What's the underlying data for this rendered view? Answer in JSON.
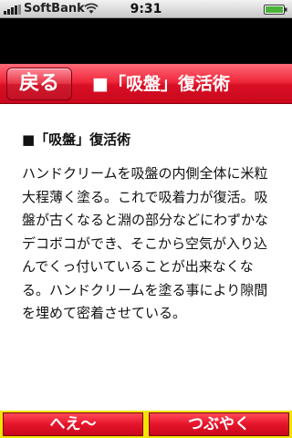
{
  "status_bar": {
    "carrier": "SoftBank",
    "time": "9:31"
  },
  "navbar": {
    "back_label": "戻る",
    "title": "■「吸盤」復活術",
    "color": "#e01a2e"
  },
  "content": {
    "heading": "■「吸盤」復活術",
    "body_lines": [
      "ハンドクリームを吸盤の内側全体に米粒",
      "大程薄く塗る。これで吸着力が復活。吸",
      "盤が古くなると淵の部分などにわずかな",
      "デコボコができ、そこから空気が入り込",
      "んでくっ付いていることが出来なくな",
      "る。ハンドクリームを塗る事により隙間",
      "を埋めて密着させている。"
    ]
  },
  "toolbar": {
    "hee_label": "へえ～",
    "tweet_label": "つぶやく",
    "background": "#f1e400"
  }
}
